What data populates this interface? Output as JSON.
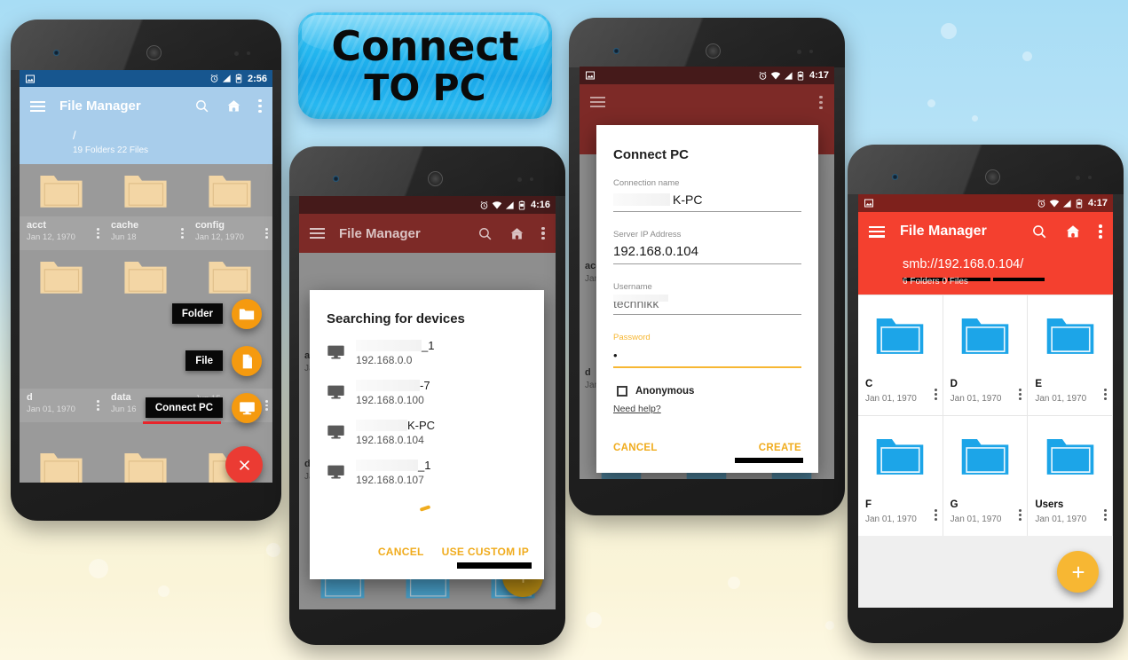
{
  "banner": {
    "line1": "Connect",
    "line2": "TO PC"
  },
  "phone1": {
    "status": {
      "time": "2:56",
      "icons": [
        "image-icon",
        "alarm-icon",
        "signal-icon",
        "battery-icon"
      ]
    },
    "toolbar": {
      "title": "File Manager",
      "icons": [
        "menu-icon",
        "search-icon",
        "home-icon",
        "overflow-icon"
      ]
    },
    "path": {
      "current": "/",
      "summary": "19 Folders 22 Files"
    },
    "items": [
      {
        "name": "acct",
        "date": "Jan 12, 1970"
      },
      {
        "name": "cache",
        "date": "Jun 18"
      },
      {
        "name": "config",
        "date": "Jan 12, 1970"
      },
      {
        "name": "",
        "date": ""
      },
      {
        "name": "",
        "date": ""
      },
      {
        "name": "",
        "date": ""
      },
      {
        "name": "d",
        "date": "Jan 01, 1970"
      },
      {
        "name": "data",
        "date": "Jun 16"
      },
      {
        "name": "",
        "date": "Jun 15"
      }
    ],
    "fab_menu": [
      {
        "label": "Folder",
        "icon": "folder-icon",
        "color": "#f59A0f"
      },
      {
        "label": "File",
        "icon": "file-icon",
        "color": "#f59A0f"
      },
      {
        "label": "Connect PC",
        "icon": "monitor-icon",
        "color": "#f59A0f"
      }
    ],
    "fab_close": {
      "icon": "close-icon",
      "color": "#eb3b33"
    },
    "colors": {
      "statusbar": "#17568f",
      "toolbar": "#a8cdeb",
      "scrim": "#9a9a9a"
    }
  },
  "phone2": {
    "status": {
      "time": "4:16",
      "icons": [
        "alarm-icon",
        "wifi-icon",
        "signal-icon",
        "battery-icon"
      ]
    },
    "toolbar": {
      "title": "File Manager",
      "icons": [
        "menu-icon",
        "search-icon",
        "home-icon",
        "overflow-icon"
      ]
    },
    "behind_items": [
      {
        "name": "acc",
        "date": "Jan"
      },
      {
        "name": "d",
        "date": "Jan"
      }
    ],
    "dialog": {
      "title": "Searching for devices",
      "devices": [
        {
          "name": "_1",
          "ip": "192.168.0.0",
          "icon": "monitor-icon",
          "redacted": true
        },
        {
          "name": "-7",
          "ip": "192.168.0.100",
          "icon": "monitor-icon",
          "redacted": true
        },
        {
          "name": "K-PC",
          "ip": "192.168.0.104",
          "icon": "monitor-icon",
          "redacted": true
        },
        {
          "name": "_1",
          "ip": "192.168.0.107",
          "icon": "monitor-icon",
          "redacted": true
        }
      ],
      "actions": [
        "CANCEL",
        "USE CUSTOM IP"
      ]
    },
    "fab": {
      "icon": "plus-icon"
    },
    "colors": {
      "statusbar": "#451a1a",
      "toolbar": "#7d2a27",
      "accent": "#f0ac1e"
    }
  },
  "phone3": {
    "status": {
      "time": "4:17",
      "icons": [
        "image-icon",
        "alarm-icon",
        "wifi-icon",
        "signal-icon",
        "battery-icon"
      ]
    },
    "dialog": {
      "title": "Connect PC",
      "fields": [
        {
          "label": "Connection name",
          "value": "K-PC",
          "redacted": true,
          "focused": false,
          "masked": false
        },
        {
          "label": "Server IP Address",
          "value": "192.168.0.104",
          "redacted": false,
          "focused": false,
          "masked": false
        },
        {
          "label": "Username",
          "value": "technikk",
          "redacted": true,
          "focused": false,
          "masked": false
        },
        {
          "label": "Password",
          "value": "•",
          "redacted": false,
          "focused": true,
          "masked": true
        }
      ],
      "checkbox": {
        "label": "Anonymous",
        "checked": false
      },
      "help_link": "Need help?",
      "actions": [
        "CANCEL",
        "CREATE"
      ]
    },
    "colors": {
      "statusbar": "#451a1a",
      "toolbar": "#7d2a27",
      "accent": "#f7b733"
    }
  },
  "phone4": {
    "status": {
      "time": "4:17",
      "icons": [
        "image-icon",
        "alarm-icon",
        "wifi-icon",
        "signal-icon",
        "battery-icon"
      ]
    },
    "toolbar": {
      "title": "File Manager",
      "icons": [
        "menu-icon",
        "search-icon",
        "home-icon",
        "overflow-icon"
      ]
    },
    "path": {
      "current": "smb://192.168.0.104/",
      "summary": "6 Folders 0 Files"
    },
    "items": [
      {
        "name": "C",
        "date": "Jan 01, 1970"
      },
      {
        "name": "D",
        "date": "Jan 01, 1970"
      },
      {
        "name": "E",
        "date": "Jan 01, 1970"
      },
      {
        "name": "F",
        "date": "Jan 01, 1970"
      },
      {
        "name": "G",
        "date": "Jan 01, 1970"
      },
      {
        "name": "Users",
        "date": "Jan 01, 1970"
      }
    ],
    "fab": {
      "icon": "plus-icon",
      "color": "#f7b733"
    },
    "colors": {
      "statusbar": "#7e211c",
      "toolbar": "#f4402f",
      "folder": "#1ca5e8"
    }
  }
}
